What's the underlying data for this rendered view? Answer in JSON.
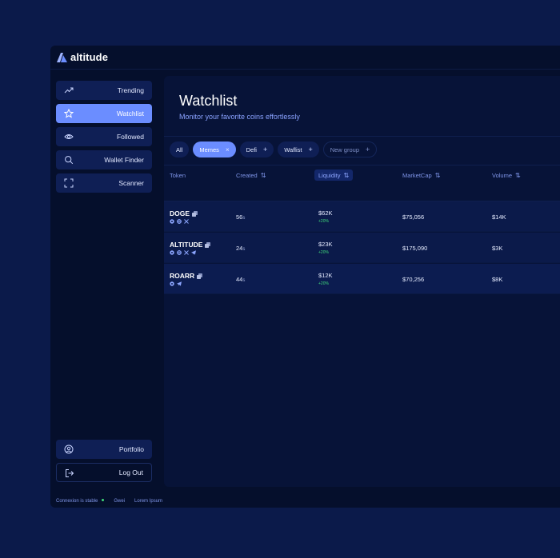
{
  "app": {
    "name": "altitude",
    "brand_color": "#6b8dff"
  },
  "sidebar": {
    "items": [
      {
        "label": "Trending",
        "icon": "trending-icon"
      },
      {
        "label": "Watchlist",
        "icon": "star-icon",
        "active": true
      },
      {
        "label": "Followed",
        "icon": "eye-icon"
      },
      {
        "label": "Wallet Finder",
        "icon": "search-icon"
      },
      {
        "label": "Scanner",
        "icon": "scan-icon"
      }
    ],
    "bottom": [
      {
        "label": "Portfolio",
        "icon": "user-circle-icon"
      },
      {
        "label": "Log Out",
        "icon": "logout-icon"
      }
    ]
  },
  "main": {
    "title": "Watchlist",
    "subtitle": "Monitor your favorite coins effortlessly",
    "groups": [
      {
        "label": "All"
      },
      {
        "label": "Memes",
        "active": true,
        "action": "×"
      },
      {
        "label": "Defi",
        "action": "+"
      },
      {
        "label": "Waflist",
        "action": "+"
      },
      {
        "label": "New group",
        "action": "+"
      }
    ],
    "columns": {
      "token": "Token",
      "created": "Created",
      "liquidity": "Liquidity",
      "marketcap": "MarketCap",
      "volume": "Volume",
      "sort_glyph": "⇅"
    },
    "rows": [
      {
        "name": "DOGE",
        "created": "56",
        "created_unit": "s",
        "liquidity": "$62K",
        "liquidity_change": "+20%",
        "marketcap": "$75,056",
        "volume": "$14K",
        "socials": [
          "web-icon",
          "globe-icon",
          "x-icon"
        ]
      },
      {
        "name": "ALTITUDE",
        "created": "24",
        "created_unit": "s",
        "liquidity": "$23K",
        "liquidity_change": "+20%",
        "marketcap": "$175,090",
        "volume": "$3K",
        "socials": [
          "web-icon",
          "globe-icon",
          "x-icon",
          "telegram-icon"
        ]
      },
      {
        "name": "ROARR",
        "created": "44",
        "created_unit": "s",
        "liquidity": "$12K",
        "liquidity_change": "+20%",
        "marketcap": "$70,256",
        "volume": "$8K",
        "socials": [
          "web-icon",
          "telegram-icon"
        ]
      }
    ]
  },
  "status": {
    "connection": "Connexion is stable",
    "connection_color": "#3fd97a",
    "items": [
      "Gwei",
      "Lorem Ipsum"
    ]
  }
}
